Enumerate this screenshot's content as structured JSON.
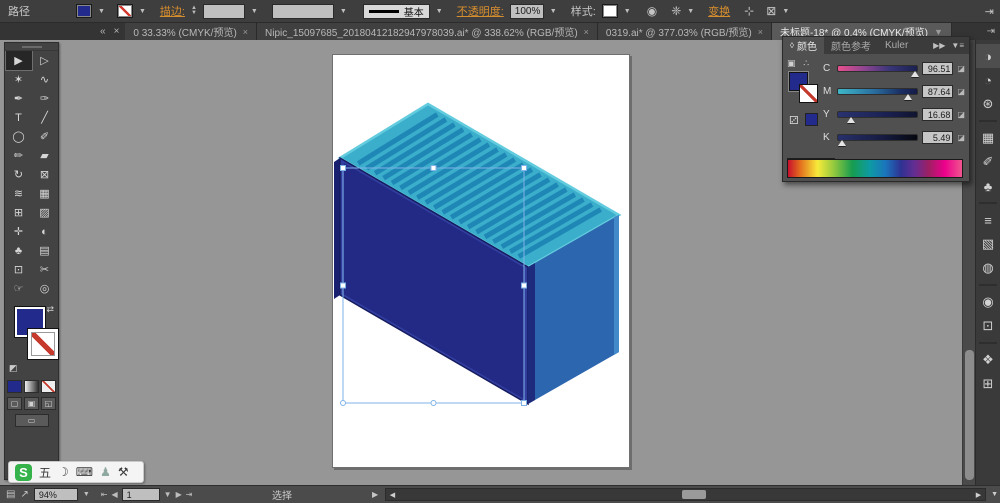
{
  "ui": {
    "dropdown": "▼",
    "up": "▲",
    "close": "×",
    "back": "«",
    "double_right": "»",
    "menu": "≡",
    "panel_end": "⇥",
    "left": "◀",
    "right": "▶",
    "first": "⇤",
    "last": "⇥",
    "diamond": "◊",
    "swap": "⇄",
    "minifs": "◩"
  },
  "control_bar": {
    "selection_label": "路径",
    "stroke_label": "描边:",
    "brush_value": "基本",
    "opacity_label": "不透明度:",
    "opacity_value": "100%",
    "style_label": "样式:",
    "recolor_icon": "◉",
    "settings_icon": "❈",
    "transform_link": "变换",
    "align_icon": "⊹",
    "isolate_icon": "⊠",
    "fill_color": "#222A8C"
  },
  "tab_bar": {
    "tabs": [
      {
        "label": "0 33.33% (CMYK/预览)",
        "close": "×"
      },
      {
        "label": "Nipic_15097685_20180412182947978039.ai* @ 338.62% (RGB/预览)",
        "close": "×"
      },
      {
        "label": "0319.ai* @ 377.03% (RGB/预览)",
        "close": "×"
      },
      {
        "label": "未标题-18* @ 0.4% (CMYK/预览)",
        "close": "▼"
      }
    ]
  },
  "toolbar": {
    "fill_color": "#222A8C",
    "tools": [
      {
        "name": "selection",
        "glyph": "▶",
        "active": true
      },
      {
        "name": "direct-selection",
        "glyph": "▷"
      },
      {
        "name": "magic-wand",
        "glyph": "✶"
      },
      {
        "name": "lasso",
        "glyph": "∿"
      },
      {
        "name": "pen",
        "glyph": "✒"
      },
      {
        "name": "curvature",
        "glyph": "✑"
      },
      {
        "name": "type",
        "glyph": "T"
      },
      {
        "name": "line-segment",
        "glyph": "╱"
      },
      {
        "name": "ellipse",
        "glyph": "◯"
      },
      {
        "name": "paintbrush",
        "glyph": "✐"
      },
      {
        "name": "pencil",
        "glyph": "✏"
      },
      {
        "name": "eraser",
        "glyph": "▰"
      },
      {
        "name": "rotate",
        "glyph": "↻"
      },
      {
        "name": "free-transform",
        "glyph": "⊠"
      },
      {
        "name": "width",
        "glyph": "≋"
      },
      {
        "name": "shape-builder",
        "glyph": "▦"
      },
      {
        "name": "perspective-grid",
        "glyph": "⊞"
      },
      {
        "name": "mesh",
        "glyph": "▨"
      },
      {
        "name": "eyedropper",
        "glyph": "✛"
      },
      {
        "name": "blend",
        "glyph": "◐"
      },
      {
        "name": "symbol-sprayer",
        "glyph": "♣"
      },
      {
        "name": "graph",
        "glyph": "▤"
      },
      {
        "name": "artboard",
        "glyph": "⊡"
      },
      {
        "name": "slice",
        "glyph": "✂"
      },
      {
        "name": "hand",
        "glyph": "☞"
      },
      {
        "name": "zoom",
        "glyph": "◎"
      }
    ]
  },
  "dock_icons": [
    {
      "name": "color",
      "glyph": "◑",
      "active": true
    },
    {
      "name": "color-guide",
      "glyph": "◔"
    },
    {
      "name": "appearance",
      "glyph": "⊛"
    },
    {
      "sep": true
    },
    {
      "name": "swatches",
      "glyph": "▦"
    },
    {
      "name": "brushes",
      "glyph": "✐"
    },
    {
      "name": "symbols",
      "glyph": "♣"
    },
    {
      "sep": true
    },
    {
      "name": "stroke",
      "glyph": "≡"
    },
    {
      "name": "gradient",
      "glyph": "▧"
    },
    {
      "name": "transparency",
      "glyph": "◍"
    },
    {
      "sep": true
    },
    {
      "name": "graphic-styles",
      "glyph": "◉"
    },
    {
      "name": "links",
      "glyph": "⊡"
    },
    {
      "sep": true
    },
    {
      "name": "layers",
      "glyph": "❖"
    },
    {
      "name": "artboards",
      "glyph": "⊞"
    }
  ],
  "color_panel": {
    "tab_color": "颜色",
    "tab_guide": "颜色参考",
    "tab_kuler": "Kuler",
    "expand_icon": "▶▶",
    "menu_icon": "▼≡",
    "mini_icon_1": "▣",
    "mini_icon_2": "∴",
    "cube_icon": "⚂",
    "badge_icon": "◪",
    "fill_color": "#222A8C",
    "chip_color": "#222A8C",
    "sliders": [
      {
        "label": "C",
        "value": "96.51",
        "percent": 96.5,
        "gradient": "linear-gradient(90deg,#E8508E,#8A4490 35%,#3A3578 65%,#1A2150 100%)"
      },
      {
        "label": "M",
        "value": "87.64",
        "percent": 87.6,
        "gradient": "linear-gradient(90deg,#3EB7C8,#2A6FA0 45%,#1A2D62 80%,#141B48 100%)"
      },
      {
        "label": "Y",
        "value": "16.68",
        "percent": 16.7,
        "gradient": "linear-gradient(90deg,#2A336F,#1A2152 60%,#10142E 100%)"
      },
      {
        "label": "K",
        "value": "5.49",
        "percent": 5.5,
        "gradient": "linear-gradient(90deg,#27306B,#141A3E 60%,#060810 100%)"
      }
    ],
    "spectrum_gradient": "linear-gradient(90deg,#C8102E,#E36F1E 7%,#F7EA39 17%,#8CC63F 27%,#169C4F 37%,#0E9BA4 47%,#1B75BC 56%,#2E3192 65%,#662D91 73%,#9E1F63 81%,#EC008C 90%,#F0558F 100%)"
  },
  "canvas": {
    "pasteboard": "#969696",
    "artboard": "#FFFFFF",
    "container": {
      "top": "#3BAECB",
      "top_stripe": "#1F87B5",
      "top_edge": "#63CBDE",
      "front": "#232A85",
      "front_frame": "#323FA0",
      "front_dark_edge": "#161C60",
      "left_sliver": "#1A2070",
      "side": "#2B66AF",
      "side_edge": "#4189C9",
      "side_shadow": "#1E2B7D",
      "selection": "#7FB3E8"
    }
  },
  "sogou_bar": {
    "logo": "S",
    "logo_color": "#35B34A",
    "mode": "五",
    "moon_icon": "☽",
    "keyboard_icon": "⌨",
    "person_icon": "♟",
    "wrench_icon": "⚒"
  },
  "status_bar": {
    "doc_icon": "▤",
    "launch_icon": "↗",
    "zoom": "94%",
    "artboard_number": "1",
    "tool_status": "选择"
  }
}
